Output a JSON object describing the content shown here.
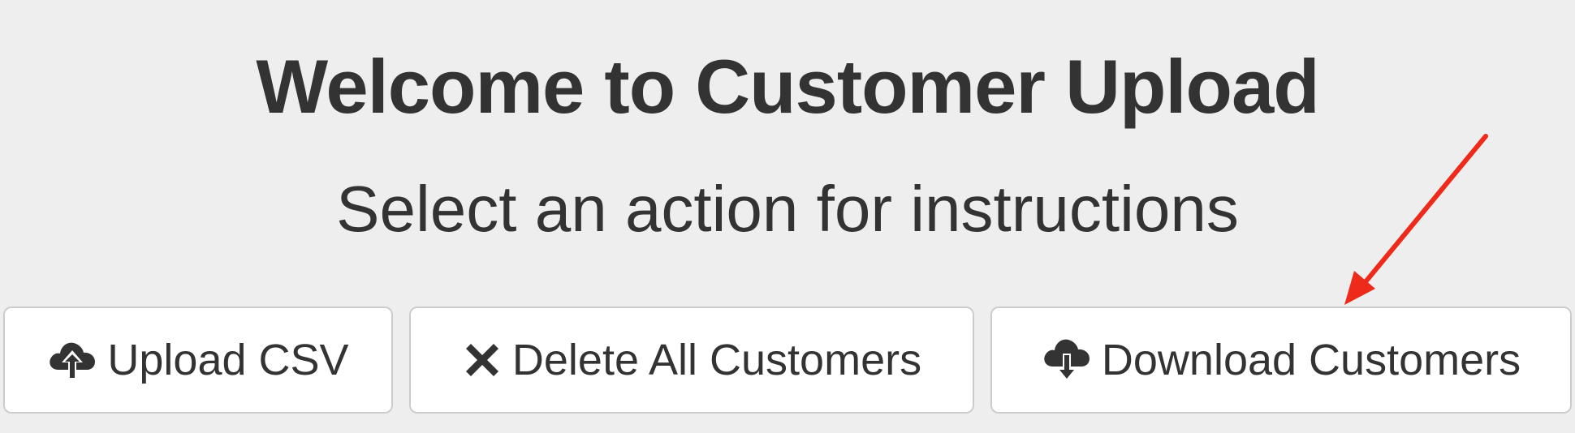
{
  "header": {
    "title": "Welcome to Customer Upload",
    "subtitle": "Select an action for instructions"
  },
  "actions": [
    {
      "label": "Upload CSV",
      "icon": "cloud-upload-icon"
    },
    {
      "label": "Delete All Customers",
      "icon": "close-icon"
    },
    {
      "label": "Download Customers",
      "icon": "cloud-download-icon"
    }
  ],
  "annotation": {
    "icon": "red-arrow-pointer",
    "color": "#ee2a1b"
  }
}
